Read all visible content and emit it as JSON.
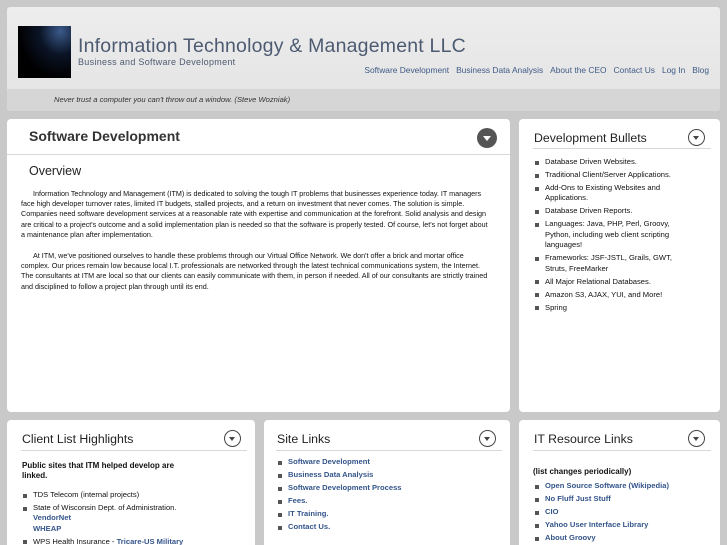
{
  "header": {
    "title": "Information Technology & Management LLC",
    "subtitle": "Business and Software Development",
    "nav": [
      "Software Development",
      "Business Data Analysis",
      "About the CEO",
      "Contact Us",
      "Log In",
      "Blog"
    ],
    "quote": "Never trust a computer you can't throw out a window. (Steve Wozniak)"
  },
  "main": {
    "title": "Software Development",
    "heading": "Overview",
    "paragraphs": [
      "Information Technology and Management (ITM) is dedicated to solving the tough IT problems that businesses experience today. IT managers face high developer turnover rates, limited IT budgets, stalled projects, and a return on investment that never comes. The solution is simple. Companies need software development services at a reasonable rate with expertise and communication at the forefront. Solid analysis and design are critical to a project's outcome and a solid implementation plan is needed so that the software is properly tested. Of course, let's not forget about a maintenance plan after implementation.",
      "At ITM, we've positioned ourselves to handle these problems through our Virtual Office Network. We don't offer a brick and mortar office complex. Our prices remain low because local I.T. professionals are networked through the latest technical communications system, the Internet. The consultants at ITM are local so that our clients can easily communicate with them, in person if needed. All of our consultants are strictly trained and disciplined to follow a project plan through until its end."
    ]
  },
  "dev_bullets": {
    "title": "Development Bullets",
    "items": [
      "Database Driven Websites.",
      "Traditional Client/Server Applications.",
      "Add-Ons to Existing Websites and Applications.",
      "Database Driven Reports.",
      "Languages: Java, PHP, Perl, Groovy, Python, including web client scripting languages!",
      "Frameworks: JSF-JSTL, Grails, GWT, Struts, FreeMarker",
      "All Major Relational Databases.",
      "Amazon S3, AJAX, YUI, and More!",
      "Spring"
    ]
  },
  "clients": {
    "title": "Client List Highlights",
    "intro": "Public sites that ITM helped develop are linked.",
    "item1": "TDS Telecom (internal projects)",
    "item2": "State of Wisconsin Dept. of Administration.",
    "item2_links": [
      "VendorNet",
      "WHEAP"
    ],
    "item3": "WPS Health Insurance - ",
    "item3_link": "Tricare-US Military"
  },
  "site_links": {
    "title": "Site Links",
    "items": [
      "Software Development",
      "Business Data Analysis",
      "Software Development Process",
      "Fees.",
      "IT Training.",
      "Contact Us."
    ]
  },
  "it_resources": {
    "title": "IT Resource Links",
    "note": "(list changes periodically)",
    "items": [
      "Open Source Software (Wikipedia)",
      "No Fluff Just Stuff",
      "CIO",
      "Yahoo User Interface Library",
      "About Groovy"
    ]
  }
}
